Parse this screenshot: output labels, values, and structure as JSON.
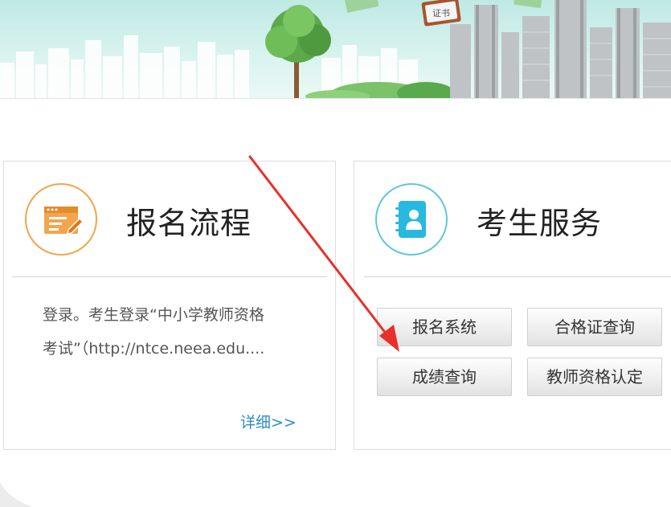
{
  "banner": {
    "sign_text": "证书"
  },
  "cards": {
    "process": {
      "title": "报名流程",
      "desc_line1": "登录。考生登录“中小学教师资格",
      "desc_line2": "考试”（http://ntce.neea.edu....",
      "more_link": "详细>>",
      "icon": "form-edit-icon",
      "accent_color": "#f2a54c"
    },
    "service": {
      "title": "考生服务",
      "icon": "contact-book-icon",
      "accent_color": "#5fc6e0",
      "buttons": {
        "register_system": "报名系统",
        "certificate_query": "合格证查询",
        "score_query": "成绩查询",
        "teacher_certification": "教师资格认定"
      }
    }
  },
  "annotation": {
    "arrow_color": "#e8302a"
  }
}
